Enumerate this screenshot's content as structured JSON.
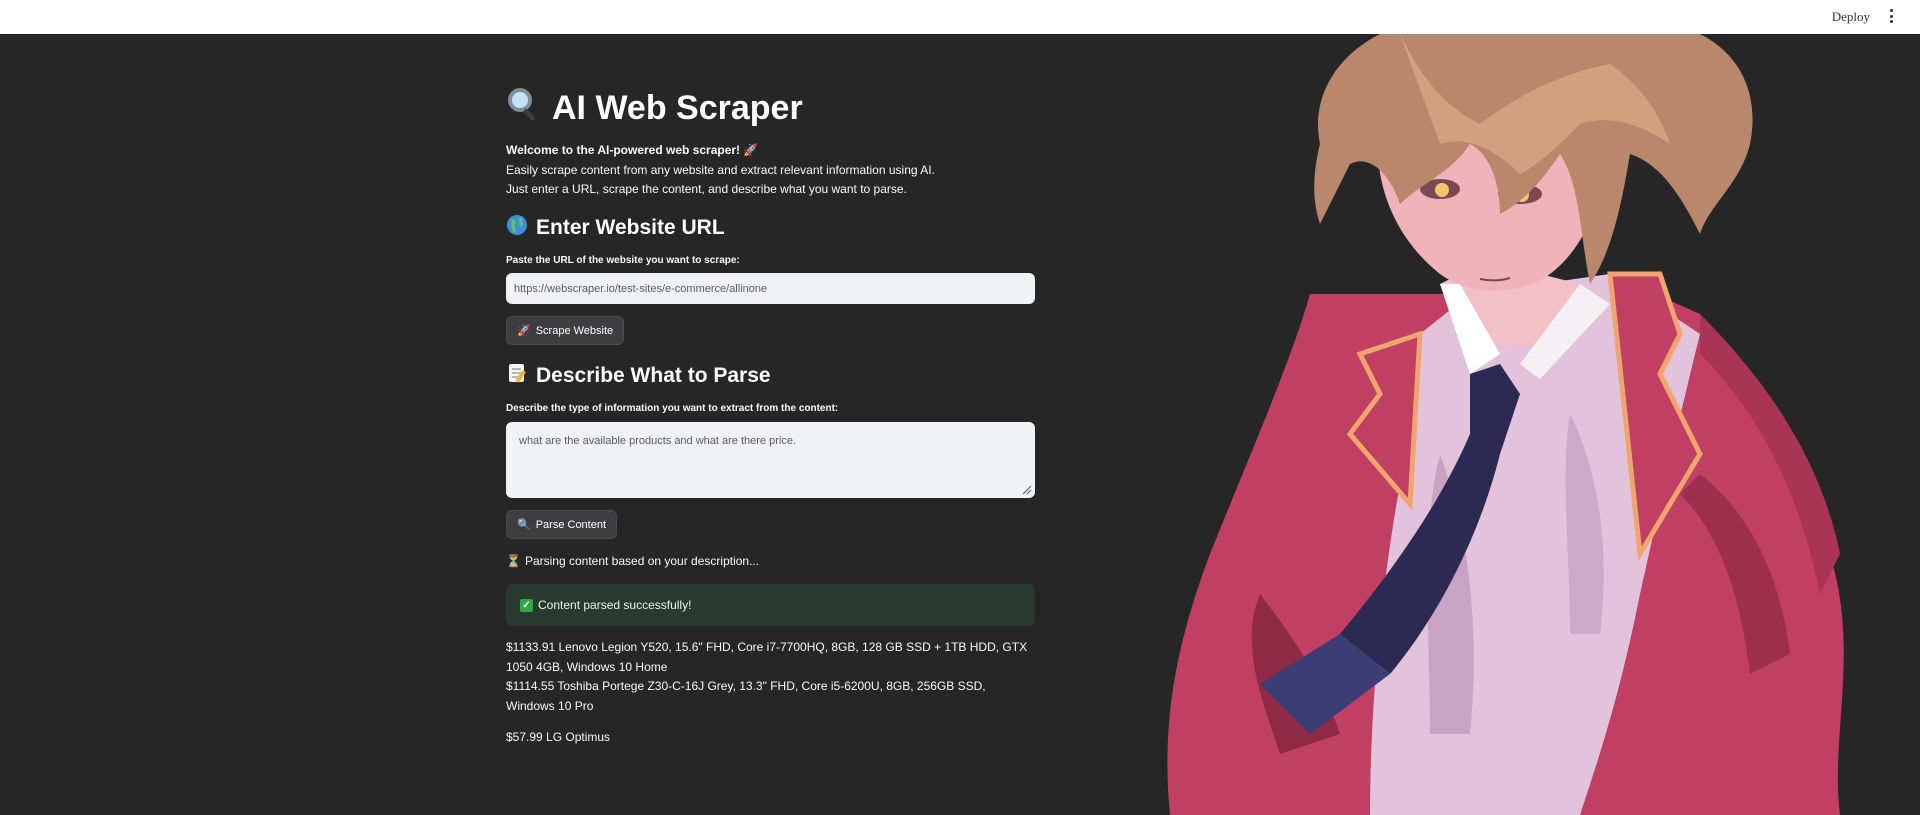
{
  "header": {
    "deploy_label": "Deploy",
    "menu_icon": "kebab-menu-icon"
  },
  "page": {
    "title": "AI Web Scraper",
    "title_icon": "magnifier-emoji",
    "intro": {
      "welcome": "Welcome to the AI-powered web scraper!",
      "line2": "Easily scrape content from any website and extract relevant information using AI.",
      "line3": "Just enter a URL, scrape the content, and describe what you want to parse."
    }
  },
  "url_section": {
    "heading": "Enter Website URL",
    "heading_icon": "globe-emoji",
    "input_label": "Paste the URL of the website you want to scrape:",
    "input_value": "https://webscraper.io/test-sites/e-commerce/allinone",
    "button_label": "Scrape Website",
    "button_icon": "rocket-emoji"
  },
  "parse_section": {
    "heading": "Describe What to Parse",
    "heading_icon": "memo-emoji",
    "textarea_label": "Describe the type of information you want to extract from the content:",
    "textarea_value": "what are the available products and what are there price.",
    "button_label": "Parse Content",
    "button_icon": "magnifier-emoji"
  },
  "status": {
    "parsing_text": "Parsing content based on your description...",
    "parsing_icon": "hourglass-emoji",
    "success_text": "Content parsed successfully!",
    "success_icon": "check-mark-emoji",
    "success_color": "#28392f"
  },
  "results": [
    "$1133.91 Lenovo Legion Y520, 15.6\" FHD, Core i7-7700HQ, 8GB, 128 GB SSD + 1TB HDD, GTX 1050 4GB, Windows 10 Home",
    "$1114.55 Toshiba Portege Z30-C-16J Grey, 13.3\" FHD, Core i5-6200U, 8GB, 256GB SSD, Windows 10 Pro",
    "$57.99 LG Optimus"
  ],
  "colors": {
    "background": "#262626",
    "topbar": "#ffffff",
    "input_bg": "#f0f2f6",
    "button_bg": "#3e3e40"
  }
}
